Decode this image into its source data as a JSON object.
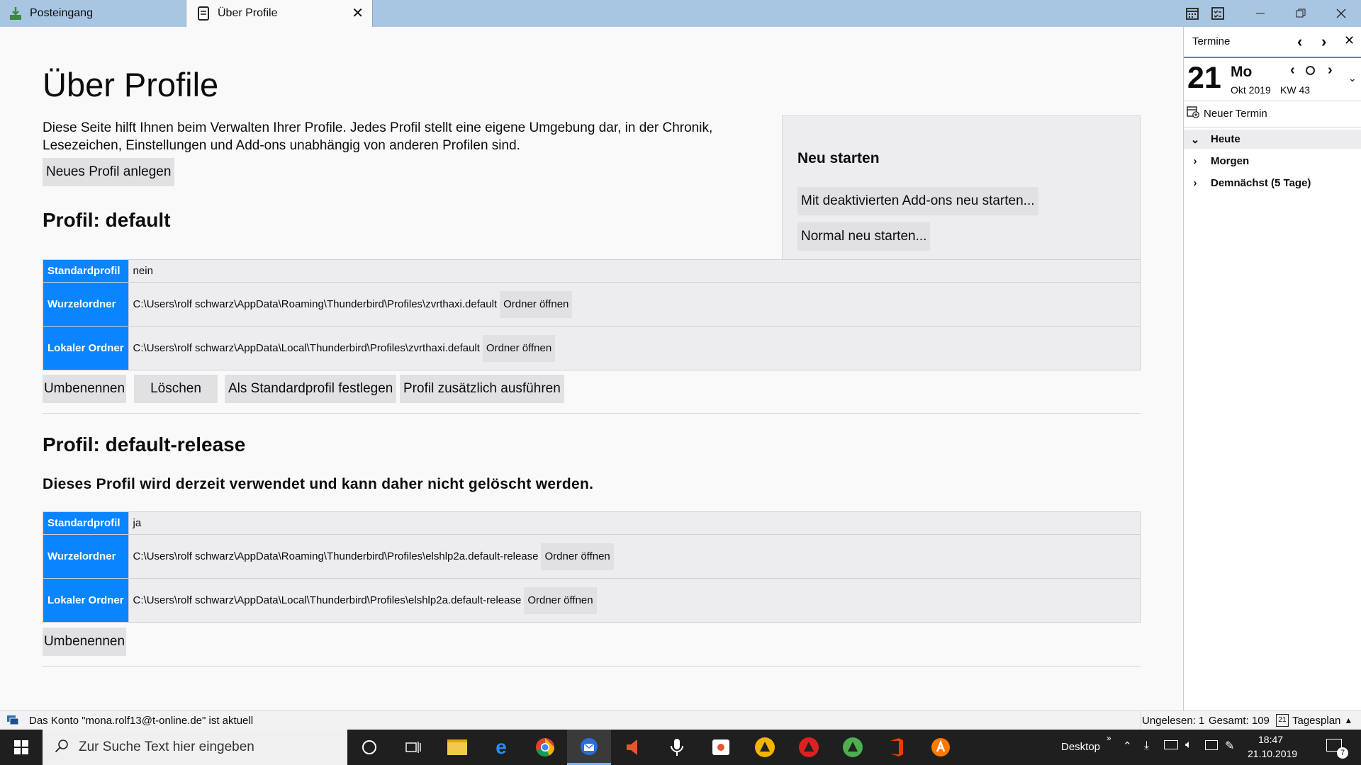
{
  "tabs": [
    {
      "label": "Posteingang"
    },
    {
      "label": "Über Profile"
    }
  ],
  "page": {
    "title": "Über Profile",
    "intro": "Diese Seite hilft Ihnen beim Verwalten Ihrer Profile. Jedes Profil stellt eine eigene Umgebung dar, in der Chronik, Lesezeichen, Einstellungen und Add-ons unabhängig von anderen Profilen sind.",
    "new_profile_button": "Neues Profil anlegen"
  },
  "restart": {
    "title": "Neu starten",
    "addons_button": "Mit deaktivierten Add-ons neu starten...",
    "normal_button": "Normal neu starten..."
  },
  "profiles": [
    {
      "heading": "Profil: default",
      "rows": {
        "default_label": "Standardprofil",
        "default_value": "nein",
        "root_label": "Wurzelordner",
        "root_value": "C:\\Users\\rolf schwarz\\AppData\\Roaming\\Thunderbird\\Profiles\\zvrthaxi.default",
        "local_label": "Lokaler Ordner",
        "local_value": "C:\\Users\\rolf schwarz\\AppData\\Local\\Thunderbird\\Profiles\\zvrthaxi.default",
        "open_folder": "Ordner öffnen"
      },
      "buttons": {
        "rename": "Umbenennen",
        "delete": "Löschen",
        "set_default": "Als Standardprofil festlegen",
        "launch": "Profil zusätzlich ausführen"
      }
    },
    {
      "heading": "Profil: default-release",
      "notice": "Dieses Profil wird derzeit verwendet und kann daher nicht gelöscht werden.",
      "rows": {
        "default_label": "Standardprofil",
        "default_value": "ja",
        "root_label": "Wurzelordner",
        "root_value": "C:\\Users\\rolf schwarz\\AppData\\Roaming\\Thunderbird\\Profiles\\elshlp2a.default-release",
        "local_label": "Lokaler Ordner",
        "local_value": "C:\\Users\\rolf schwarz\\AppData\\Local\\Thunderbird\\Profiles\\elshlp2a.default-release",
        "open_folder": "Ordner öffnen"
      },
      "buttons": {
        "rename": "Umbenennen"
      }
    }
  ],
  "sidebar": {
    "title": "Termine",
    "day": "21",
    "weekday": "Mo",
    "month_year": "Okt 2019",
    "week": "KW 43",
    "new_event": "Neuer Termin",
    "groups": [
      {
        "label": "Heute",
        "expanded": true
      },
      {
        "label": "Morgen",
        "expanded": false
      },
      {
        "label": "Demnächst (5 Tage)",
        "expanded": false
      }
    ]
  },
  "status": {
    "message": "Das Konto \"mona.rolf13@t-online.de\" ist aktuell",
    "unread": "Ungelesen: 1",
    "total": "Gesamt: 109",
    "today_pane": "Tagesplan",
    "today_pane_day": "21"
  },
  "taskbar": {
    "search_placeholder": "Zur Suche Text hier eingeben",
    "desktop_label": "Desktop",
    "time": "18:47",
    "date": "21.10.2019",
    "notifications": "7"
  },
  "colors": {
    "accent": "#0a84ff",
    "tabbar": "#a8c6e2",
    "taskbar": "#1f1f1f"
  }
}
